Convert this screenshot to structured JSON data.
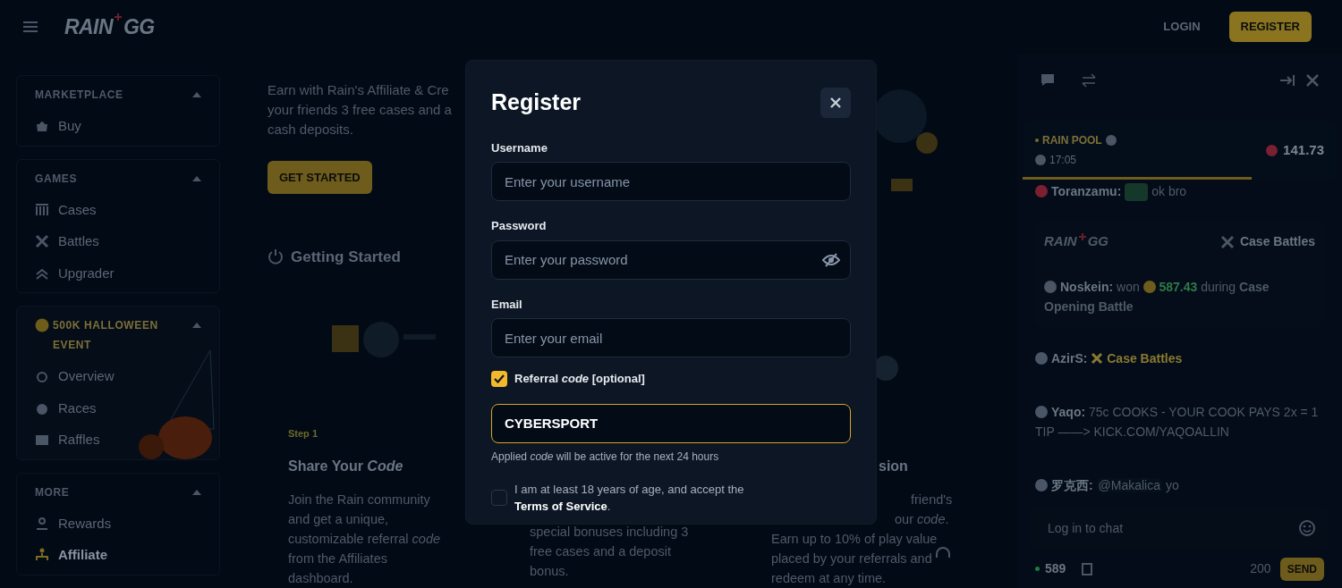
{
  "top_bar": {
    "logo": {
      "left": "RAIN",
      "right": "GG"
    },
    "login": "LOGIN",
    "register": "REGISTER"
  },
  "sidebar": {
    "sections": [
      {
        "title": "MARKETPLACE",
        "expanded": true,
        "items": [
          {
            "label": "Buy",
            "selected": false
          }
        ]
      },
      {
        "title": "GAMES",
        "expanded": true,
        "items": [
          {
            "label": "Cases",
            "selected": false
          },
          {
            "label": "Battles",
            "selected": false
          },
          {
            "label": "Upgrader",
            "selected": false
          }
        ]
      },
      {
        "title": "500K HALLOWEEN EVENT",
        "expanded": true,
        "items": [
          {
            "label": "Overview",
            "selected": false
          },
          {
            "label": "Races",
            "selected": false
          },
          {
            "label": "Raffles",
            "selected": false
          }
        ]
      },
      {
        "title": "MORE",
        "expanded": true,
        "items": [
          {
            "label": "Rewards",
            "selected": false
          },
          {
            "label": "Affiliate",
            "selected": true
          }
        ]
      }
    ]
  },
  "main": {
    "intro_lines": [
      "Earn with Rain's Affiliate & Cre",
      "your friends 3 free cases and a",
      "cash deposits."
    ],
    "get_started": "GET STARTED",
    "section_title": "Getting Started",
    "steps": [
      {
        "step": "Step 1",
        "title": "Share Your *Code*",
        "lines": [
          "Join the Rain community",
          "and get a unique,",
          "customizable referral *code*",
          "from the Affiliates",
          "dashboard."
        ]
      },
      {
        "lines": [
          "special bonuses including 3",
          "free cases and a deposit",
          "bonus."
        ]
      },
      {
        "title": "sion",
        "lines": [
          "friend's",
          "our *code*.",
          "Earn up to 10% of play value",
          "placed by your referrals and",
          "redeem at any time."
        ]
      }
    ]
  },
  "modal": {
    "title": "Register",
    "fields": [
      {
        "label": "Username",
        "placeholder": "Enter your username"
      },
      {
        "label": "Password",
        "placeholder": "Enter your password"
      },
      {
        "label": "Email",
        "placeholder": "Enter your email"
      }
    ],
    "referral": {
      "checked": true,
      "label": "Referral *code* [optional]",
      "value": "CYBERSPORT",
      "hint": "Applied *code* will be active for the next 24 hours"
    },
    "terms": {
      "checked": false,
      "text": "I am at least 18 years of age, and accept the",
      "link": "Terms of Service",
      "tail": "."
    }
  },
  "chat": {
    "rain_pool": {
      "title": "RAIN POOL",
      "time": "17:05",
      "amount": "141.73",
      "level": 0.73
    },
    "messages": [
      {
        "kind": "text",
        "user": "Toranzamu:",
        "text": "ok bro"
      },
      {
        "kind": "win",
        "brand": {
          "left": "RAIN",
          "right": "GG"
        },
        "game": "Case Battles",
        "user": "Noskein:",
        "text": "won",
        "amount": "587.43",
        "tail": "during **Case Opening Battle**"
      },
      {
        "kind": "link",
        "user": "AzirS:",
        "text": "Case Battles"
      },
      {
        "kind": "text",
        "user": "Yaqo:",
        "text": "75c COOKS - YOUR COOK PAYS 2x = 1 TIP ——> KICK.COM/YAQOALLIN"
      },
      {
        "kind": "mention",
        "user": "罗克西:",
        "mention": "@Makalica",
        "text": "yo"
      }
    ],
    "input": {
      "placeholder": "Log in to chat"
    },
    "online": "589",
    "chars": "200",
    "send": "SEND"
  }
}
